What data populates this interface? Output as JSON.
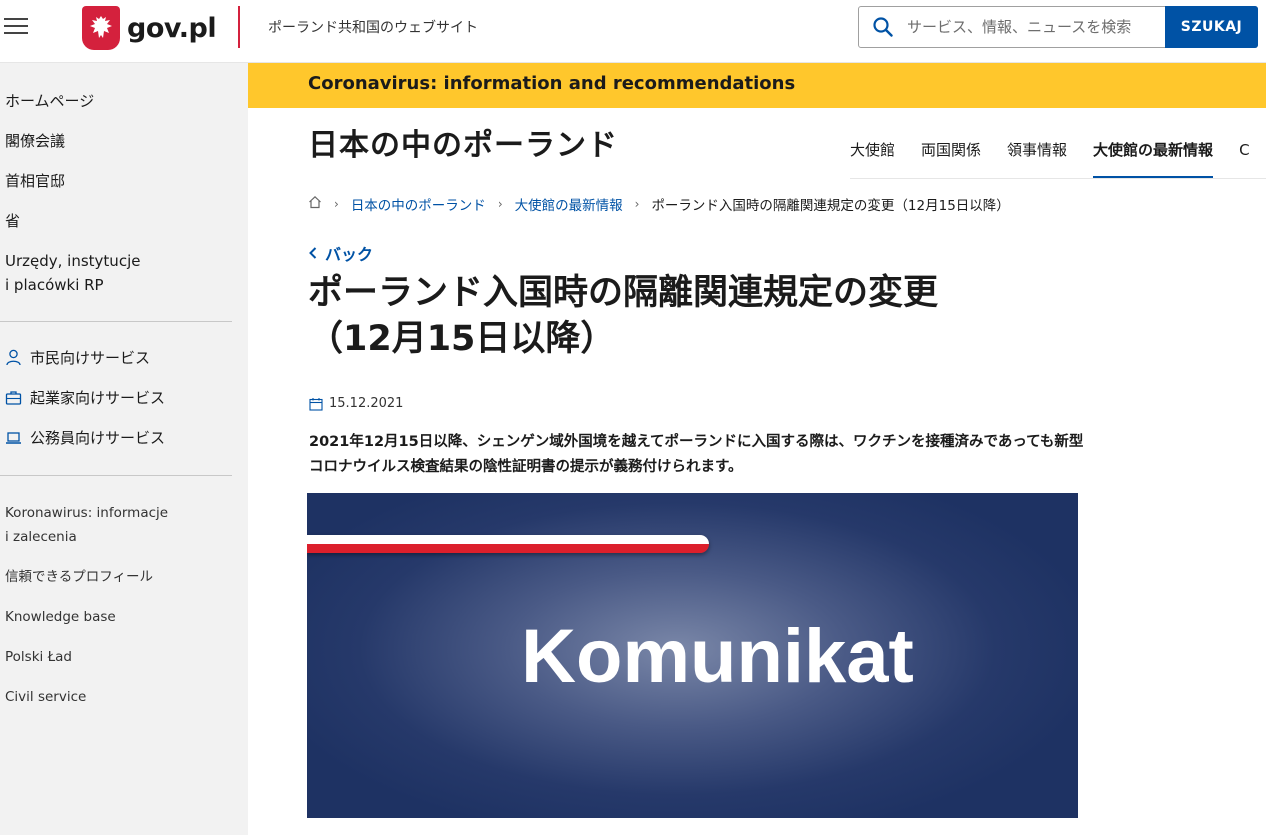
{
  "header": {
    "logo_text": "gov.pl",
    "tagline": "ポーランド共和国のウェブサイト",
    "search_placeholder": "サービス、情報、ニュースを検索",
    "search_button": "SZUKAJ"
  },
  "sidebar": {
    "main_items": [
      {
        "label": "ホームページ"
      },
      {
        "label": "閣僚会議"
      },
      {
        "label": "首相官邸"
      },
      {
        "label": "省"
      },
      {
        "label_line1": "Urzędy, instytucje",
        "label_line2": "i placówki RP"
      }
    ],
    "services": [
      {
        "label": "市民向けサービス",
        "icon": "person-icon"
      },
      {
        "label": "起業家向けサービス",
        "icon": "briefcase-icon"
      },
      {
        "label": "公務員向けサービス",
        "icon": "laptop-icon"
      }
    ],
    "links": [
      {
        "label_line1": "Koronawirus: informacje",
        "label_line2": "i zalecenia"
      },
      {
        "label": "信頼できるプロフィール"
      },
      {
        "label": "Knowledge base"
      },
      {
        "label": "Polski Ład"
      },
      {
        "label": "Civil service"
      }
    ]
  },
  "banner": {
    "text": "Coronavirus: information and recommendations",
    "color": "#ffc72c"
  },
  "site": {
    "title": "日本の中のポーランド",
    "nav": [
      {
        "label": "大使館",
        "active": false
      },
      {
        "label": "両国関係",
        "active": false
      },
      {
        "label": "領事情報",
        "active": false
      },
      {
        "label": "大使館の最新情報",
        "active": true
      },
      {
        "label": "C",
        "active": false
      }
    ]
  },
  "breadcrumb": {
    "items": [
      "日本の中のポーランド",
      "大使館の最新情報"
    ],
    "current": "ポーランド入国時の隔離関連規定の変更（12月15日以降）"
  },
  "article": {
    "back_label": "バック",
    "title_line1": "ポーランド入国時の隔離関連規定の変更",
    "title_line2": "（12月15日以降）",
    "date": "15.12.2021",
    "lead": "2021年12月15日以降、シェンゲン域外国境を越えてポーランドに入国する際は、ワクチンを接種済みであっても新型コロナウイルス検査結果の陰性証明書の提示が義務付けられます。",
    "image_text": "Komunikat"
  },
  "colors": {
    "accent": "#0052a5",
    "brand_red": "#d4213d"
  }
}
